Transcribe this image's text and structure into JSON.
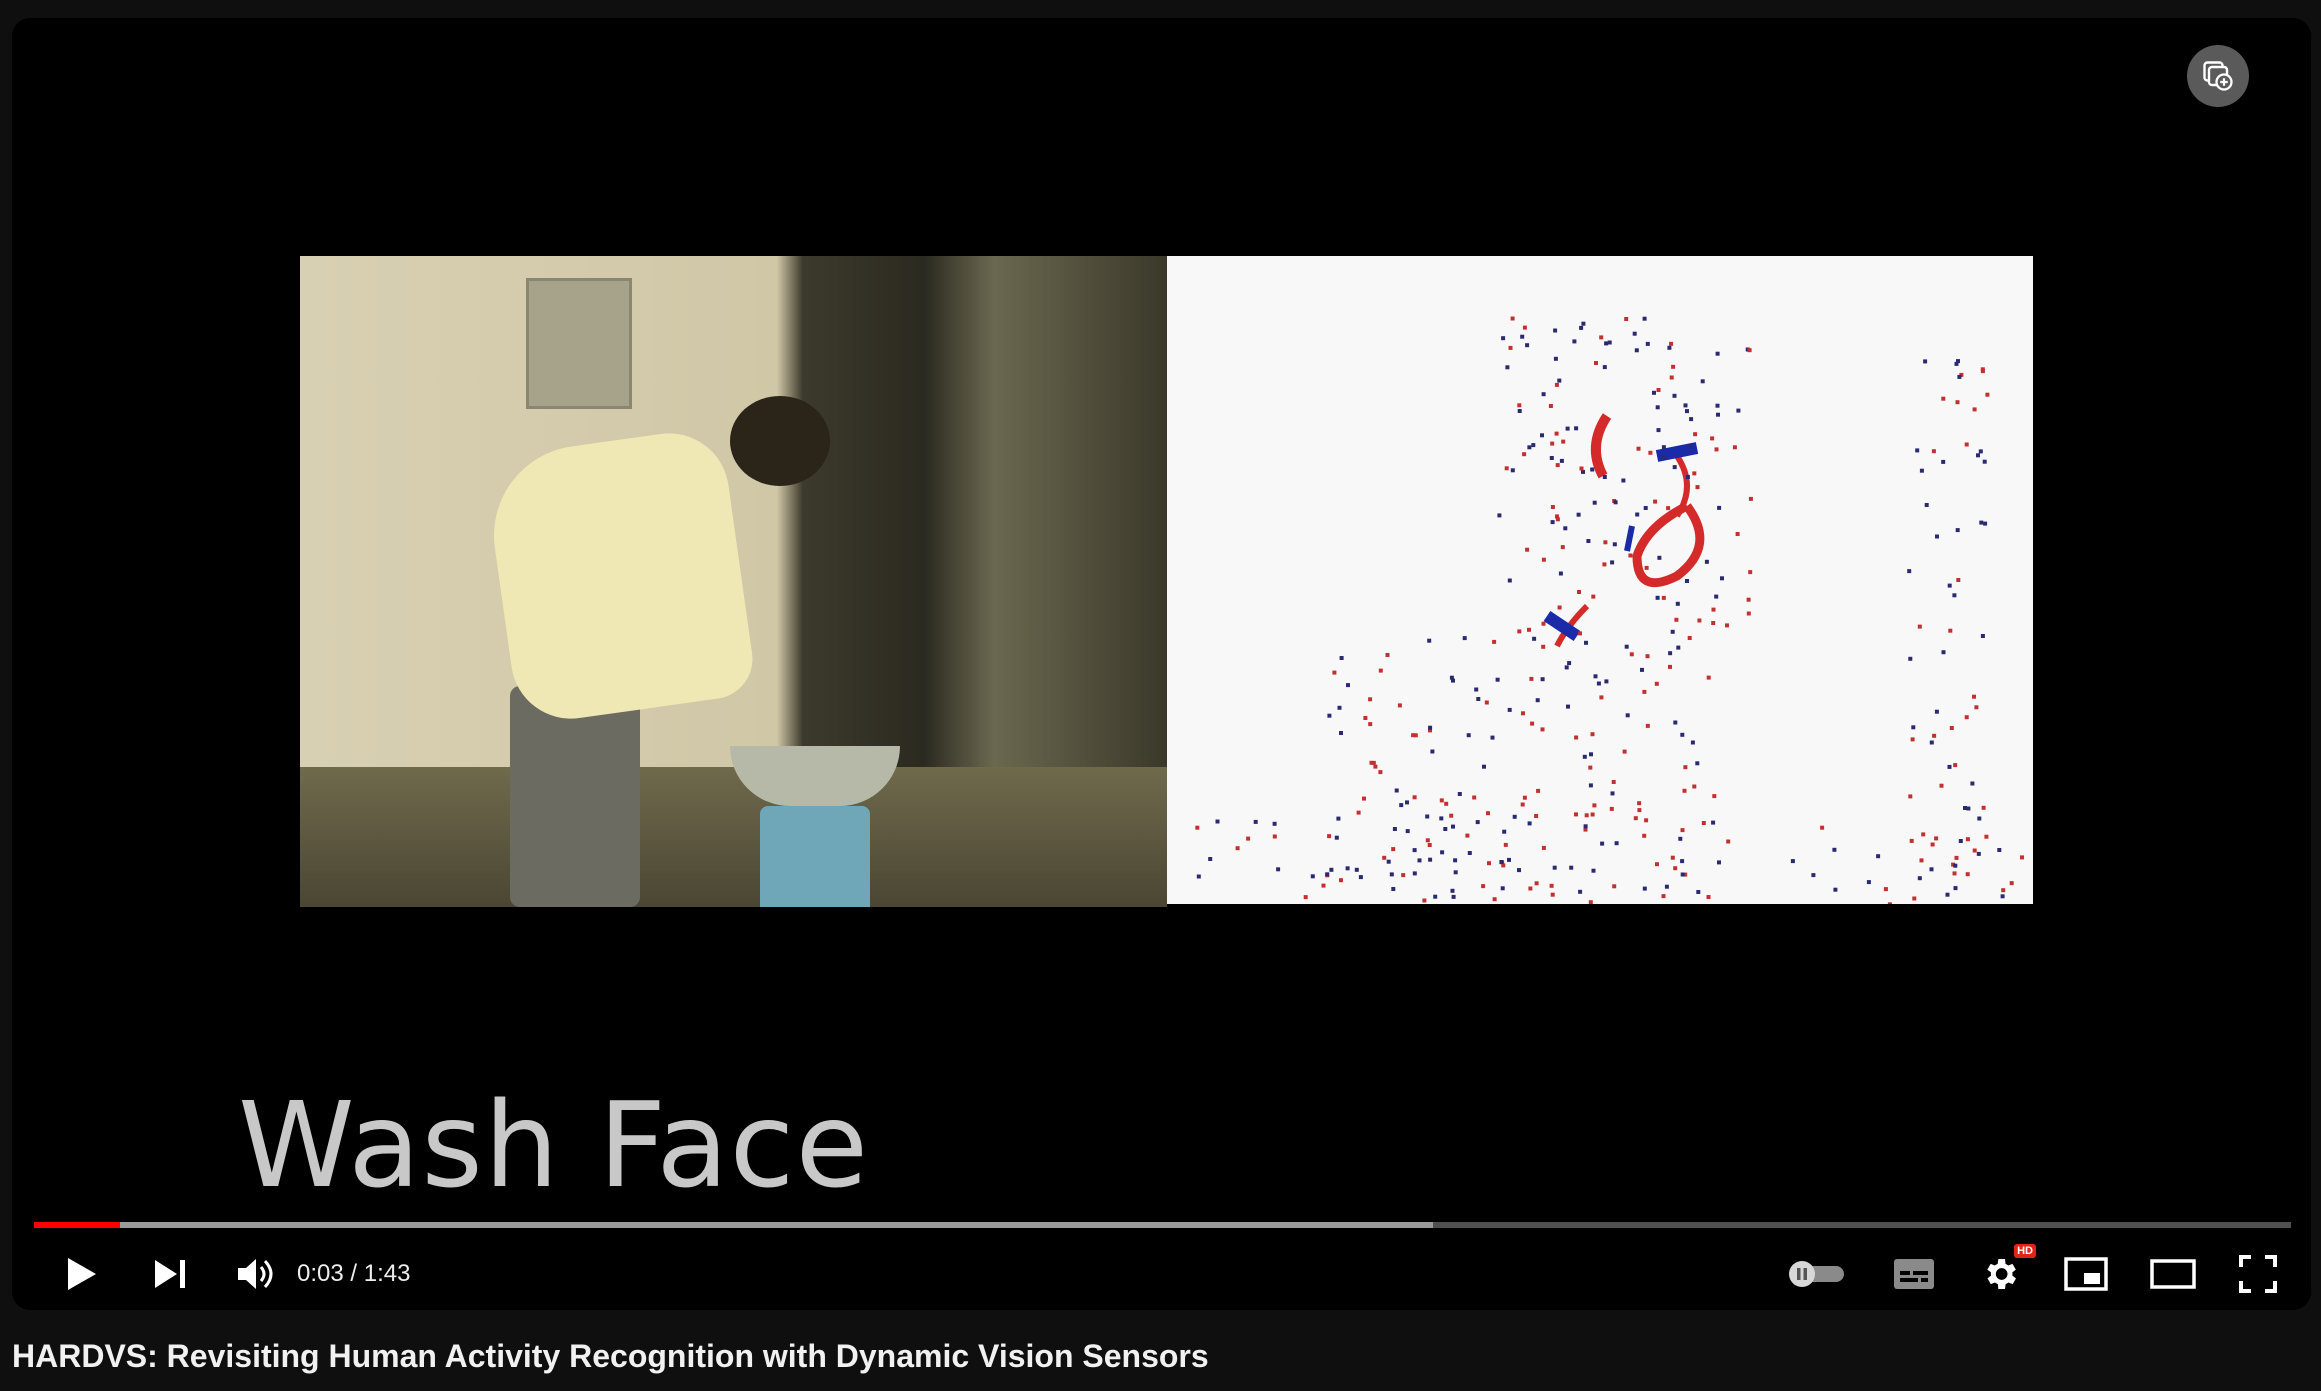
{
  "video": {
    "title": "HARDVS: Revisiting Human Activity Recognition with Dynamic Vision Sensors",
    "caption": "Wash Face"
  },
  "player": {
    "current_time": "0:03",
    "duration": "1:43",
    "time_display": "0:03 / 1:43",
    "played_fraction": 0.038,
    "buffered_fraction": 0.62,
    "hd_badge": "HD"
  },
  "icons": {
    "play": "play-icon",
    "next": "next-icon",
    "volume": "volume-icon",
    "autoplay": "autoplay-toggle-icon",
    "subtitles": "subtitles-icon",
    "settings": "gear-icon",
    "miniplayer": "miniplayer-icon",
    "theater": "theater-mode-icon",
    "fullscreen": "fullscreen-icon",
    "add_to_playlist": "add-to-playlist-icon"
  },
  "colors": {
    "progress_played": "#ff0000",
    "event_positive": "#d42a2a",
    "event_negative": "#1a2aa8"
  }
}
